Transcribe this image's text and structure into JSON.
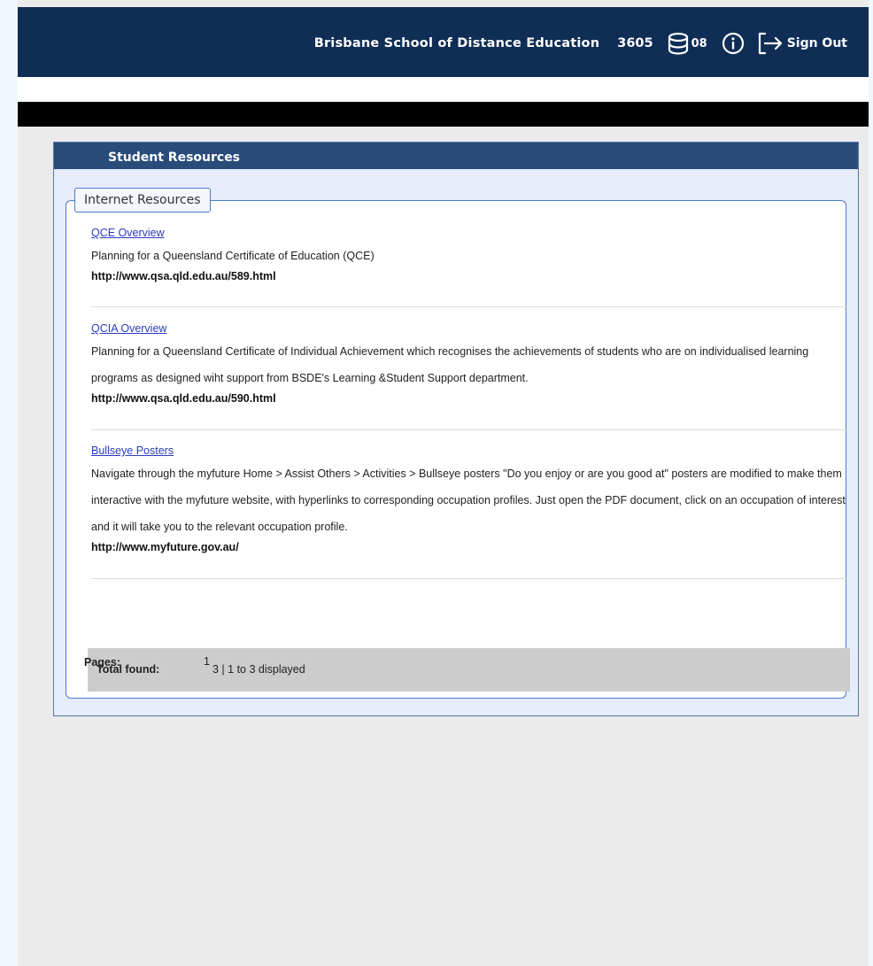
{
  "header": {
    "school_name": "Brisbane School of Distance Education",
    "school_code": "3605",
    "database_icon": "database-icon",
    "database_number": "08",
    "info_icon": "info-icon",
    "signout_icon": "sign-out-icon",
    "signout_label": "Sign Out",
    "background_color": "#0f2d55"
  },
  "panel": {
    "title": "Student Resources",
    "legend": "Internet Resources",
    "resources": [
      {
        "title": "QCE Overview",
        "description": "Planning for a Queensland Certificate of Education (QCE)",
        "url": "http://www.qsa.qld.edu.au/589.html"
      },
      {
        "title": "QCIA Overview",
        "description": "Planning for a Queensland Certificate of Individual Achievement which recognises the achievements of students who are on individualised learning programs as designed wiht support from BSDE's Learning &Student Support department.",
        "url": "http://www.qsa.qld.edu.au/590.html"
      },
      {
        "title": "Bullseye Posters",
        "description": "Navigate through the myfuture Home > Assist Others > Activities > Bullseye posters \"Do you enjoy or are you good at\" posters are modified to make them interactive with the myfuture website, with hyperlinks to corresponding occupation profiles. Just open the PDF document, click on an occupation of interest and it will take you to the relevant occupation profile.",
        "url": "http://www.myfuture.gov.au/"
      }
    ],
    "total_label": "Total found:",
    "total_value": "3 | 1 to 3 displayed",
    "pages_label": "Pages:",
    "pages_value": "1"
  }
}
